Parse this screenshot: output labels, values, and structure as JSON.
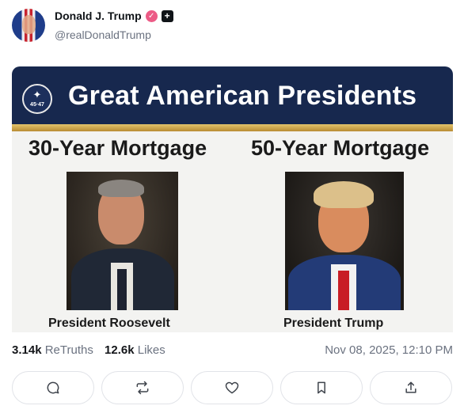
{
  "author": {
    "display_name": "Donald J. Trump",
    "handle": "@realDonaldTrump",
    "verified_icon": "verified-check-icon",
    "badge_icon": "plus-badge-icon"
  },
  "post_image": {
    "banner_title": "Great American Presidents",
    "seal_text": "45·47",
    "left_heading": "30-Year Mortgage",
    "right_heading": "50-Year Mortgage",
    "left_caption": "President Roosevelt",
    "right_caption": "President Trump",
    "colors": {
      "banner": "#17284e",
      "gold": "#d4ae52"
    }
  },
  "stats": {
    "retruths_count": "3.14k",
    "retruths_label": "ReTruths",
    "likes_count": "12.6k",
    "likes_label": "Likes",
    "timestamp": "Nov 08, 2025, 12:10 PM"
  },
  "actions": [
    {
      "icon": "reply-icon"
    },
    {
      "icon": "retruth-icon"
    },
    {
      "icon": "like-heart-icon"
    },
    {
      "icon": "bookmark-icon"
    },
    {
      "icon": "share-icon"
    }
  ]
}
